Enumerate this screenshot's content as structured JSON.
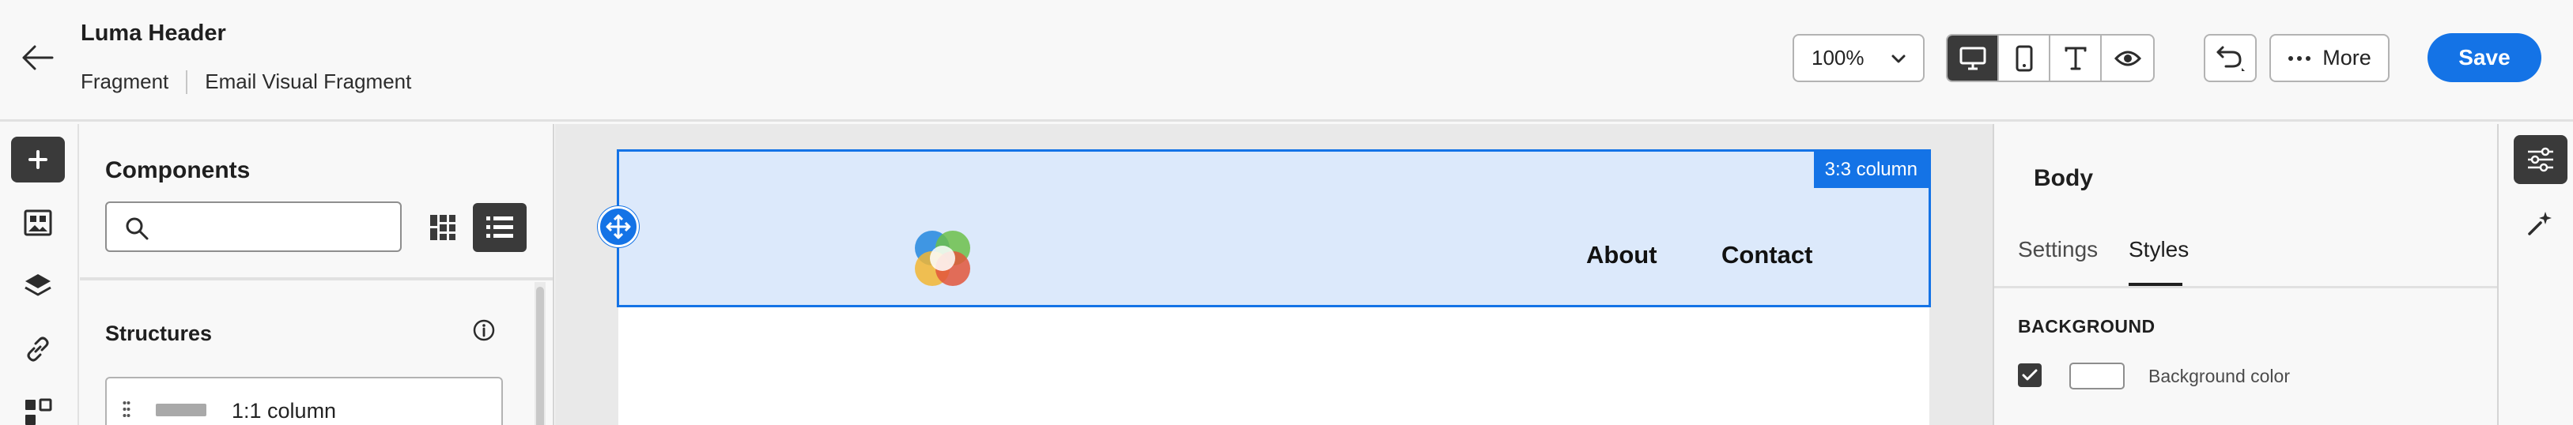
{
  "header": {
    "title": "Luma Header",
    "breadcrumb": [
      "Fragment",
      "Email Visual Fragment"
    ],
    "zoom": "100%",
    "more_label": "More",
    "save_label": "Save"
  },
  "components": {
    "title": "Components",
    "search_placeholder": "",
    "structures_title": "Structures",
    "structure_items": [
      {
        "label": "1:1 column"
      }
    ]
  },
  "canvas": {
    "column_badge": "3:3 column",
    "nav": {
      "about": "About",
      "contact": "Contact"
    }
  },
  "properties": {
    "title": "Body",
    "tabs": [
      {
        "label": "Settings",
        "active": false
      },
      {
        "label": "Styles",
        "active": true
      }
    ],
    "section": "BACKGROUND",
    "background_color_label": "Background color",
    "background_checked": true
  },
  "colors": {
    "accent": "#1473e6",
    "selection_fill": "#dce9fb",
    "dark_button": "#3a3a3a"
  },
  "icons": {
    "back": "arrow-left-icon",
    "view_modes": [
      "desktop-icon",
      "mobile-icon",
      "text-icon",
      "eye-icon"
    ],
    "left_rail": [
      "add-icon",
      "image-components-icon",
      "layers-icon",
      "link-icon",
      "fragments-icon"
    ],
    "right_rail": [
      "properties-sliders-icon",
      "magic-wand-icon"
    ]
  }
}
